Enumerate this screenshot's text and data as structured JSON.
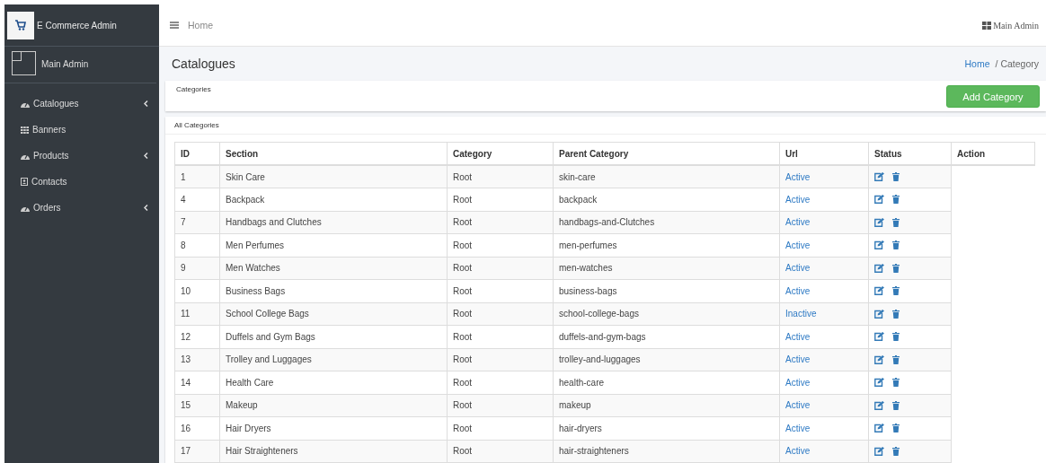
{
  "sidebar": {
    "brand": "E Commerce Admin",
    "user": "Main Admin",
    "items": [
      {
        "label": "Catalogues",
        "has_submenu": true
      },
      {
        "label": "Banners",
        "has_submenu": false
      },
      {
        "label": "Products",
        "has_submenu": true
      },
      {
        "label": "Contacts",
        "has_submenu": false
      },
      {
        "label": "Orders",
        "has_submenu": true
      }
    ]
  },
  "topbar": {
    "home": "Home",
    "user": "Main Admin"
  },
  "page": {
    "title": "Catalogues",
    "breadcrumb": [
      "Home",
      "/ Category"
    ]
  },
  "card": {
    "title": "Categories",
    "button": "Add Category"
  },
  "table": {
    "title": "All Categories",
    "columns": [
      "ID",
      "Section",
      "Category",
      "Parent Category",
      "Url",
      "Status",
      "Action"
    ],
    "rows": [
      [
        "1",
        "Skin Care",
        "Root",
        "skin-care",
        "Active"
      ],
      [
        "4",
        "Backpack",
        "Root",
        "backpack",
        "Active"
      ],
      [
        "7",
        "Handbags and Clutches",
        "Root",
        "handbags-and-Clutches",
        "Active"
      ],
      [
        "8",
        "Men Perfumes",
        "Root",
        "men-perfumes",
        "Active"
      ],
      [
        "9",
        "Men Watches",
        "Root",
        "men-watches",
        "Active"
      ],
      [
        "10",
        "Business Bags",
        "Root",
        "business-bags",
        "Active"
      ],
      [
        "11",
        "School College Bags",
        "Root",
        "school-college-bags",
        "Inactive"
      ],
      [
        "12",
        "Duffels and Gym Bags",
        "Root",
        "duffels-and-gym-bags",
        "Active"
      ],
      [
        "13",
        "Trolley and Luggages",
        "Root",
        "trolley-and-luggages",
        "Active"
      ],
      [
        "14",
        "Health Care",
        "Root",
        "health-care",
        "Active"
      ],
      [
        "15",
        "Makeup",
        "Root",
        "makeup",
        "Active"
      ],
      [
        "16",
        "Hair Dryers",
        "Root",
        "hair-dryers",
        "Active"
      ],
      [
        "17",
        "Hair Straighteners",
        "Root",
        "hair-straighteners",
        "Active"
      ]
    ]
  }
}
